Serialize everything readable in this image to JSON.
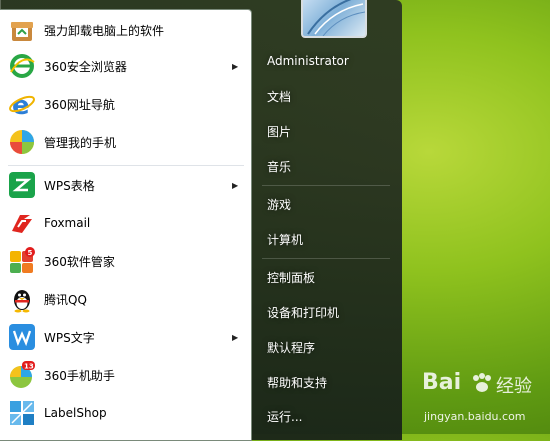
{
  "programs": [
    {
      "label": "强力卸载电脑上的软件",
      "icon": "uninstall-box-icon",
      "submenu": false
    },
    {
      "label": "360安全浏览器",
      "icon": "360-browser-icon",
      "submenu": true
    },
    {
      "label": "360网址导航",
      "icon": "ie-e-icon",
      "submenu": false
    },
    {
      "label": "管理我的手机",
      "icon": "phone-manager-icon",
      "submenu": false
    },
    {
      "label": "WPS表格",
      "icon": "wps-spreadsheet-icon",
      "submenu": true
    },
    {
      "label": "Foxmail",
      "icon": "foxmail-icon",
      "submenu": false
    },
    {
      "label": "360软件管家",
      "icon": "360-software-manager-icon",
      "submenu": false,
      "badge": "5"
    },
    {
      "label": "腾讯QQ",
      "icon": "qq-penguin-icon",
      "submenu": false
    },
    {
      "label": "WPS文字",
      "icon": "wps-writer-icon",
      "submenu": true
    },
    {
      "label": "360手机助手",
      "icon": "360-phone-assistant-icon",
      "submenu": false,
      "badge": "13"
    },
    {
      "label": "LabelShop",
      "icon": "labelshop-icon",
      "submenu": false
    }
  ],
  "right_menu": [
    "Administrator",
    "文档",
    "图片",
    "音乐",
    "游戏",
    "计算机",
    "控制面板",
    "设备和打印机",
    "默认程序",
    "帮助和支持",
    "运行..."
  ],
  "watermark": {
    "brand": "Bai",
    "brand2": "经验",
    "url": "jingyan.baidu.com"
  },
  "colors": {
    "desktop_green": "#8fc21e",
    "menu_frame": "#263024",
    "wps_green": "#1aa34a",
    "wps_blue": "#2a8ee0"
  }
}
